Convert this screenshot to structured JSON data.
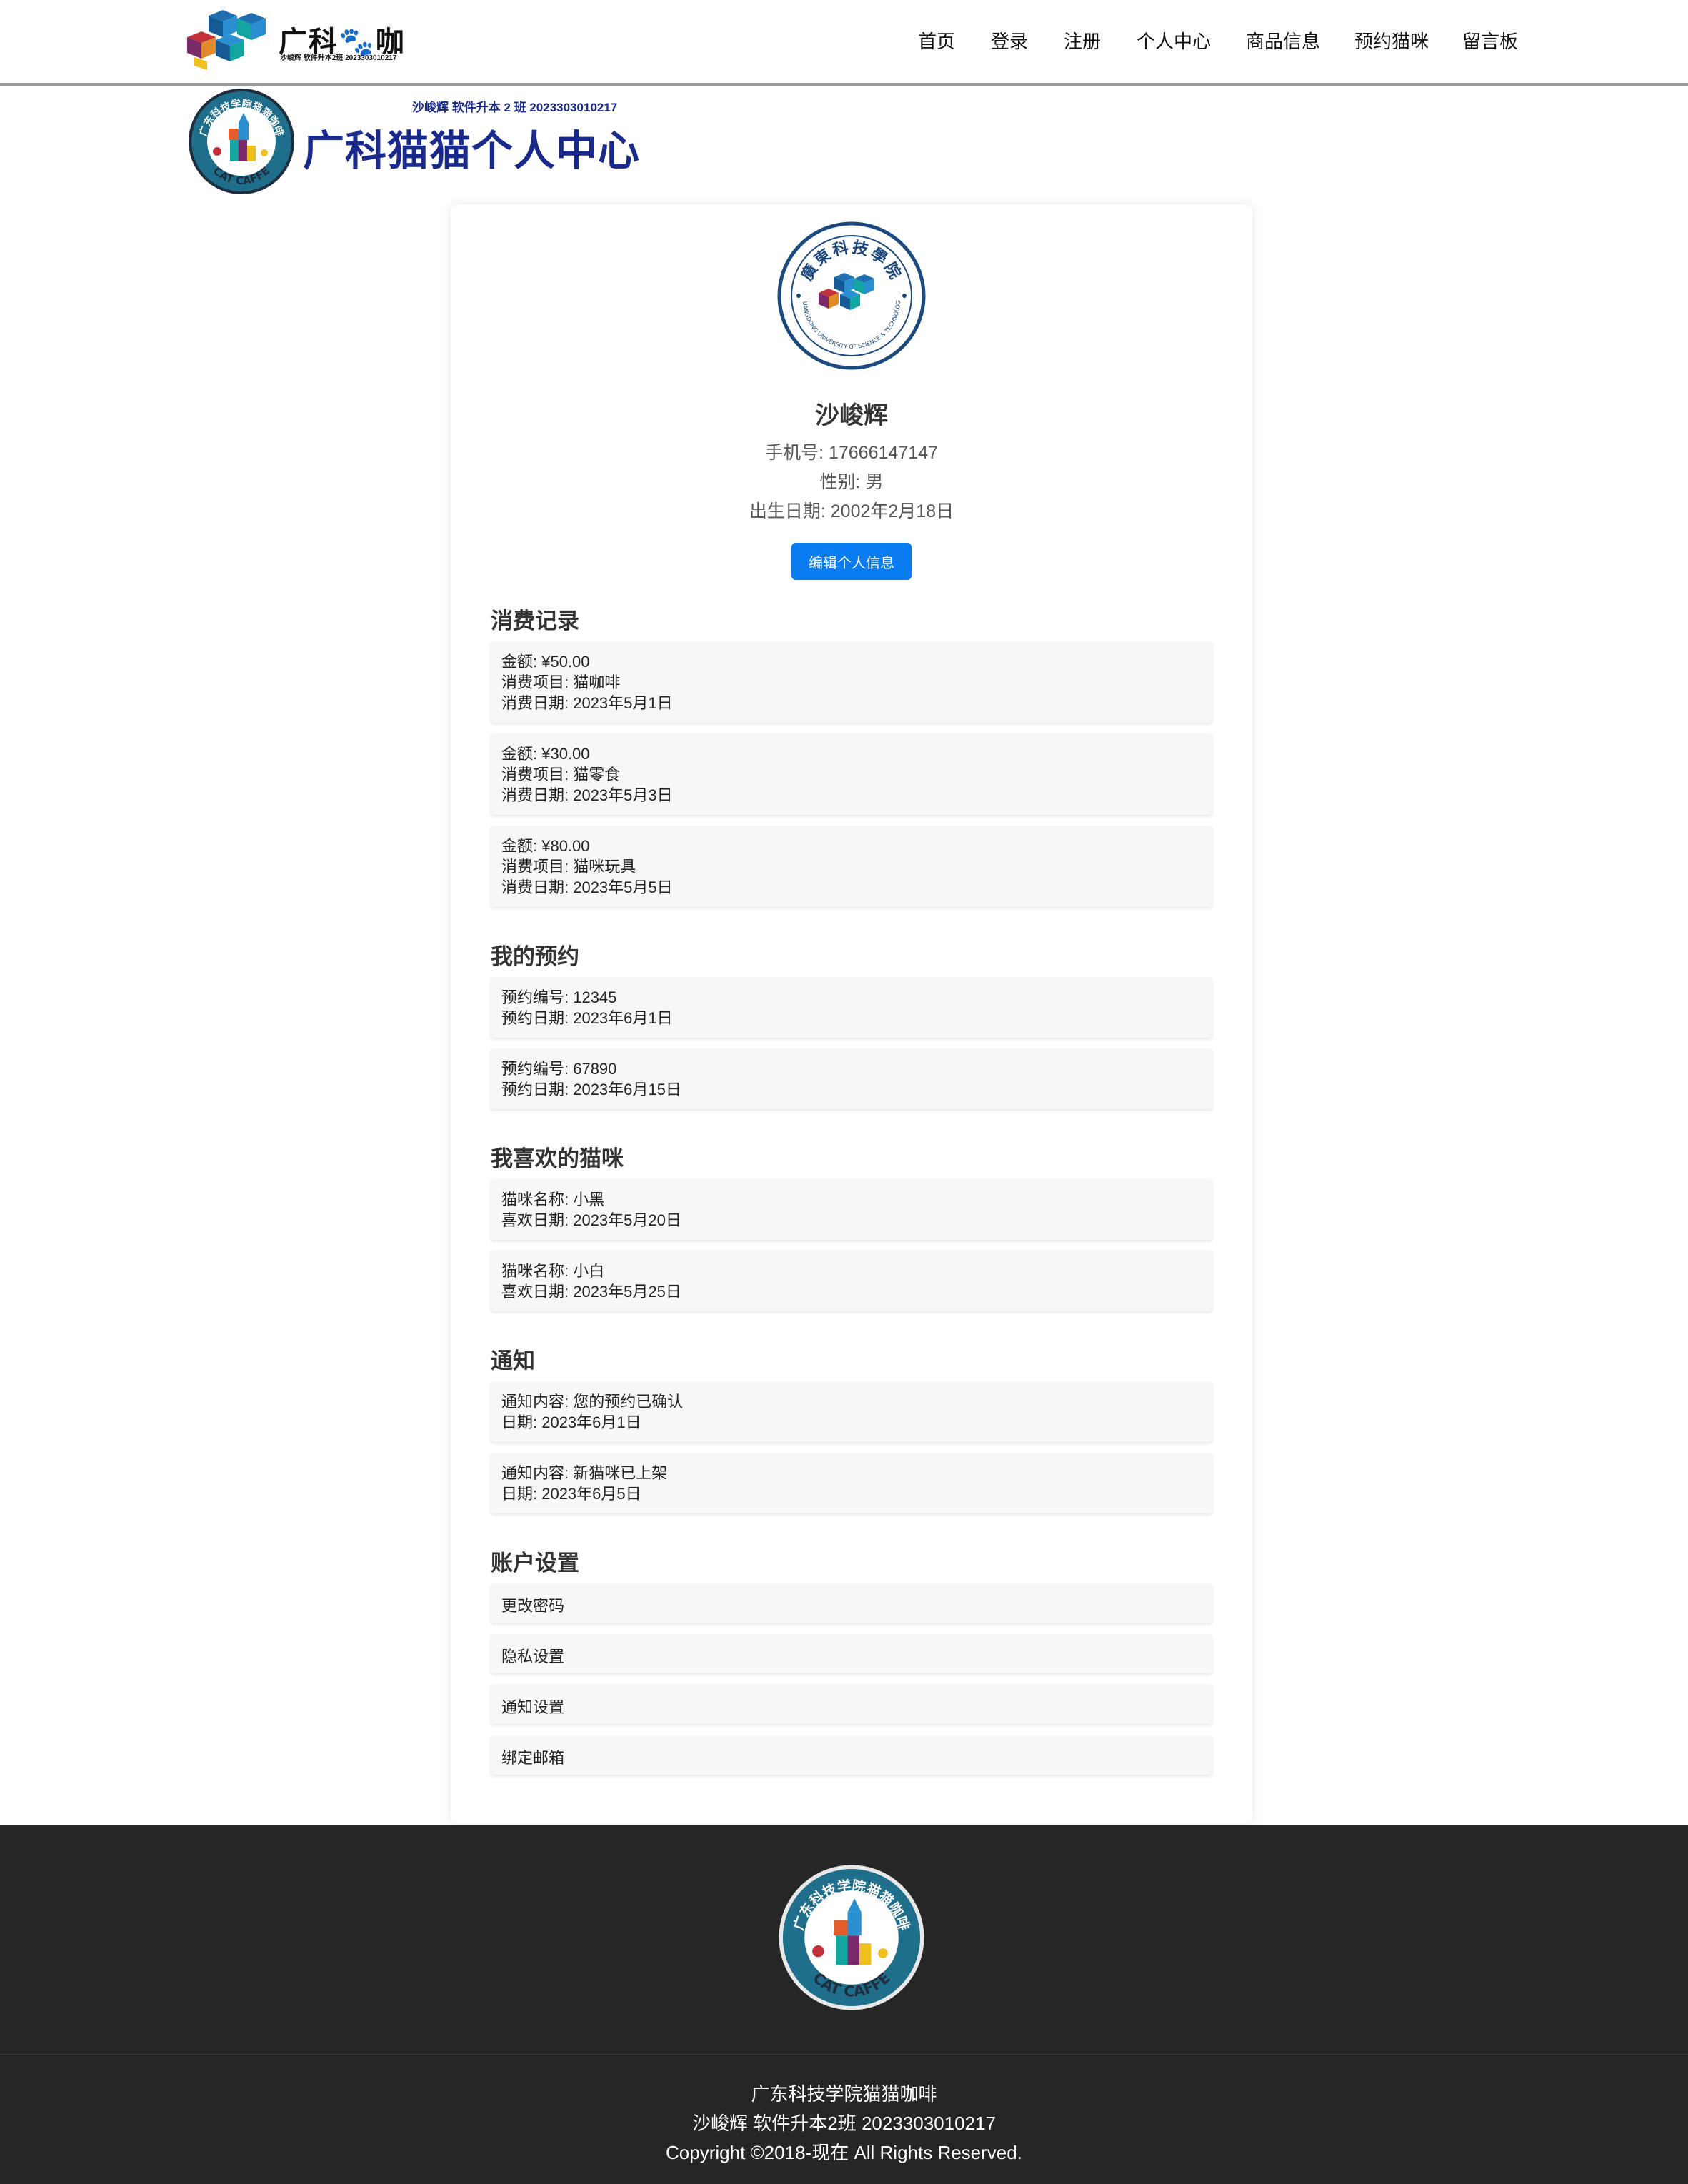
{
  "nav": {
    "brand": "广科🐾咖",
    "brand_sub": "沙峻辉 软件升本2班 2023303010217",
    "links": [
      "首页",
      "登录",
      "注册",
      "个人中心",
      "商品信息",
      "预约猫咪",
      "留言板"
    ]
  },
  "banner": {
    "subtitle": "沙峻辉 软件升本 2 班 2023303010217",
    "title": "广科猫猫个人中心",
    "emblem_top_text": "广东科技学院猫猫咖啡",
    "emblem_bottom_text": "CAT CAFFE"
  },
  "profile": {
    "seal_top_text": "廣東科技學院",
    "seal_ring_text": "GUANGDONG UNIVERSITY OF SCIENCE & TECHNOLOGY",
    "name": "沙峻辉",
    "phone": "手机号: 17666147147",
    "gender": "性别: 男",
    "birth": "出生日期: 2002年2月18日",
    "edit_label": "编辑个人信息"
  },
  "consumption": {
    "title": "消费记录",
    "items": [
      {
        "amount": "金额: ¥50.00",
        "item": "消费项目: 猫咖啡",
        "date": "消费日期: 2023年5月1日"
      },
      {
        "amount": "金额: ¥30.00",
        "item": "消费项目: 猫零食",
        "date": "消费日期: 2023年5月3日"
      },
      {
        "amount": "金额: ¥80.00",
        "item": "消费项目: 猫咪玩具",
        "date": "消费日期: 2023年5月5日"
      }
    ]
  },
  "reservations": {
    "title": "我的预约",
    "items": [
      {
        "id": "预约编号: 12345",
        "date": "预约日期: 2023年6月1日"
      },
      {
        "id": "预约编号: 67890",
        "date": "预约日期: 2023年6月15日"
      }
    ]
  },
  "favorites": {
    "title": "我喜欢的猫咪",
    "items": [
      {
        "name": "猫咪名称: 小黑",
        "date": "喜欢日期: 2023年5月20日"
      },
      {
        "name": "猫咪名称: 小白",
        "date": "喜欢日期: 2023年5月25日"
      }
    ]
  },
  "notifications": {
    "title": "通知",
    "items": [
      {
        "content": "通知内容: 您的预约已确认",
        "date": "日期: 2023年6月1日"
      },
      {
        "content": "通知内容: 新猫咪已上架",
        "date": "日期: 2023年6月5日"
      }
    ]
  },
  "settings": {
    "title": "账户设置",
    "items": [
      "更改密码",
      "隐私设置",
      "通知设置",
      "绑定邮箱"
    ]
  },
  "footer": {
    "line1": "广东科技学院猫猫咖啡",
    "line2": "沙峻辉 软件升本2班 2023303010217",
    "line3": "Copyright ©2018-现在 All Rights Reserved."
  },
  "colors": {
    "accent_blue": "#0a7cf2",
    "banner_navy": "#1a2a8a",
    "footer_bg": "#262626",
    "emblem_teal": "#1f6e8c"
  }
}
